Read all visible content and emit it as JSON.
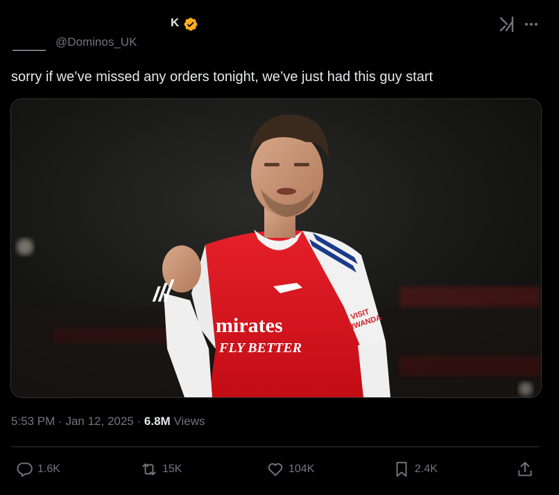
{
  "author": {
    "display_name": "K",
    "handle": "@Dominos_UK",
    "verified": true,
    "verified_color": "#ffad1f"
  },
  "tweet": {
    "text": "sorry if we’ve missed any orders tonight, we’ve just had this guy start",
    "media": {
      "shirt_sponsor_line1": "mirates",
      "shirt_sponsor_line2": "FLY BETTER",
      "sleeve_text_line1": "VISIT",
      "sleeve_text_line2": "RWANDA"
    }
  },
  "meta": {
    "time": "5:53 PM",
    "separator1": "·",
    "date": "Jan 12, 2025",
    "separator2": "·",
    "views_count": "6.8M",
    "views_label": "Views"
  },
  "actions": {
    "replies": "1.6K",
    "retweets": "15K",
    "likes": "104K",
    "bookmarks": "2.4K"
  },
  "icons": {
    "verified": "verified-badge-icon",
    "grok": "grok-icon",
    "more": "more-icon",
    "reply": "reply-icon",
    "retweet": "retweet-icon",
    "like": "heart-icon",
    "bookmark": "bookmark-icon",
    "share": "share-icon"
  },
  "colors": {
    "background": "#000000",
    "text_primary": "#e7e9ea",
    "text_secondary": "#71767b",
    "divider": "#2f3336",
    "shirt_red": "#db0007"
  }
}
